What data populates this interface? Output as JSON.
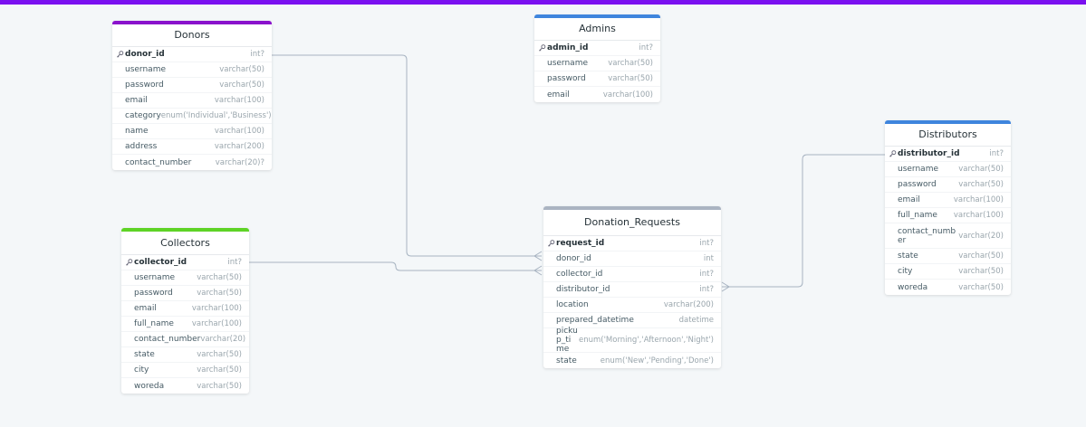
{
  "colors": {
    "top_bar": "#7a10f0",
    "donors_accent": "#8a12cc",
    "admins_accent": "#3f85dd",
    "distributors_accent": "#3f85dd",
    "collectors_accent": "#5ed326",
    "donation_requests_accent": "#aab4c2",
    "connector": "#a7b3c1"
  },
  "icons": {
    "primary_key": "key-icon"
  },
  "tables": {
    "donors": {
      "title": "Donors",
      "fields": [
        {
          "name": "donor_id",
          "type": "int?"
        },
        {
          "name": "username",
          "type": "varchar(50)"
        },
        {
          "name": "password",
          "type": "varchar(50)"
        },
        {
          "name": "email",
          "type": "varchar(100)"
        },
        {
          "name": "category",
          "type": "enum('Individual','Business')"
        },
        {
          "name": "name",
          "type": "varchar(100)"
        },
        {
          "name": "address",
          "type": "varchar(200)"
        },
        {
          "name": "contact_number",
          "type": "varchar(20)?"
        }
      ]
    },
    "admins": {
      "title": "Admins",
      "fields": [
        {
          "name": "admin_id",
          "type": "int?"
        },
        {
          "name": "username",
          "type": "varchar(50)"
        },
        {
          "name": "password",
          "type": "varchar(50)"
        },
        {
          "name": "email",
          "type": "varchar(100)"
        }
      ]
    },
    "distributors": {
      "title": "Distributors",
      "fields": [
        {
          "name": "distributor_id",
          "type": "int?"
        },
        {
          "name": "username",
          "type": "varchar(50)"
        },
        {
          "name": "password",
          "type": "varchar(50)"
        },
        {
          "name": "email",
          "type": "varchar(100)"
        },
        {
          "name": "full_name",
          "type": "varchar(100)"
        },
        {
          "name": "contact_number",
          "type": "varchar(20)"
        },
        {
          "name": "state",
          "type": "varchar(50)"
        },
        {
          "name": "city",
          "type": "varchar(50)"
        },
        {
          "name": "woreda",
          "type": "varchar(50)"
        }
      ]
    },
    "collectors": {
      "title": "Collectors",
      "fields": [
        {
          "name": "collector_id",
          "type": "int?"
        },
        {
          "name": "username",
          "type": "varchar(50)"
        },
        {
          "name": "password",
          "type": "varchar(50)"
        },
        {
          "name": "email",
          "type": "varchar(100)"
        },
        {
          "name": "full_name",
          "type": "varchar(100)"
        },
        {
          "name": "contact_number",
          "type": "varchar(20)"
        },
        {
          "name": "state",
          "type": "varchar(50)"
        },
        {
          "name": "city",
          "type": "varchar(50)"
        },
        {
          "name": "woreda",
          "type": "varchar(50)"
        }
      ]
    },
    "donation_requests": {
      "title": "Donation_Requests",
      "fields": [
        {
          "name": "request_id",
          "type": "int?"
        },
        {
          "name": "donor_id",
          "type": "int"
        },
        {
          "name": "collector_id",
          "type": "int?"
        },
        {
          "name": "distributor_id",
          "type": "int?"
        },
        {
          "name": "location",
          "type": "varchar(200)"
        },
        {
          "name": "prepared_datetime",
          "type": "datetime"
        },
        {
          "name": "pickup_time",
          "type": "enum('Morning','Afternoon','Night')"
        },
        {
          "name": "state",
          "type": "enum('New','Pending','Done')"
        }
      ]
    }
  },
  "relationships": [
    {
      "from": "Donors.donor_id",
      "to": "Donation_Requests.donor_id",
      "cardinality": "one-to-many"
    },
    {
      "from": "Collectors.collector_id",
      "to": "Donation_Requests.collector_id",
      "cardinality": "one-to-many"
    },
    {
      "from": "Distributors.distributor_id",
      "to": "Donation_Requests.distributor_id",
      "cardinality": "one-to-many"
    }
  ]
}
